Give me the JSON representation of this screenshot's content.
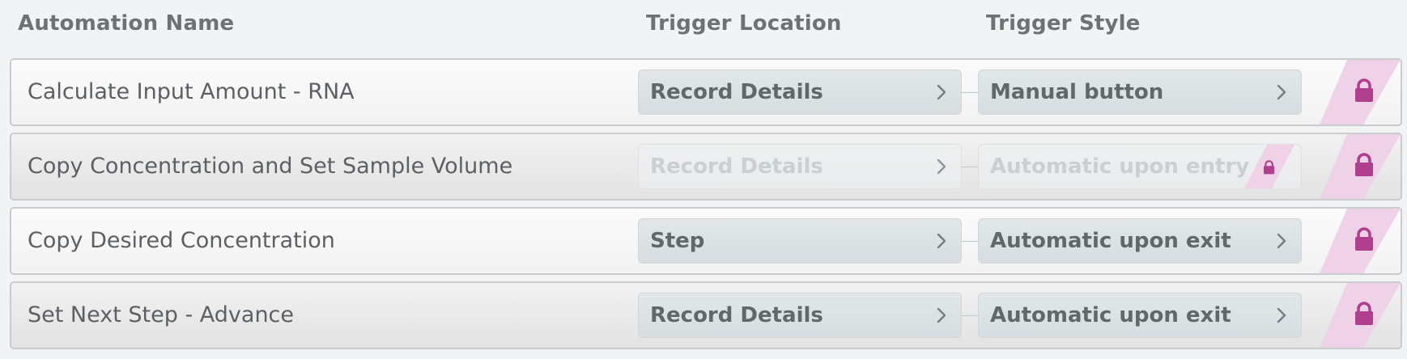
{
  "header": {
    "name": "Automation Name",
    "location": "Trigger Location",
    "style": "Trigger Style"
  },
  "rows": [
    {
      "name": "Calculate Input Amount - RNA",
      "location": "Record Details",
      "style": "Manual button",
      "location_enabled": true,
      "style_enabled": true
    },
    {
      "name": "Copy Concentration and Set Sample Volume",
      "location": "Record Details",
      "style": "Automatic upon entry",
      "location_enabled": false,
      "style_enabled": false
    },
    {
      "name": "Copy Desired Concentration",
      "location": "Step",
      "style": "Automatic upon exit",
      "location_enabled": true,
      "style_enabled": true
    },
    {
      "name": "Set Next Step - Advance",
      "location": "Record Details",
      "style": "Automatic upon exit",
      "location_enabled": true,
      "style_enabled": true
    }
  ],
  "icons": {
    "chevron": "chevron-right-icon",
    "lock": "lock-icon"
  },
  "colors": {
    "lock": "#b0408e",
    "lock_stripe": "#efd2e7",
    "chevron": "#777c80",
    "chevron_disabled": "#9aa0a4"
  }
}
